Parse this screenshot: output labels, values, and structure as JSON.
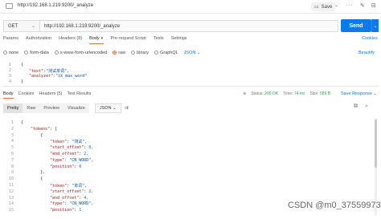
{
  "topbar": {
    "title": "http://192.168.1.219:9200/_analyze",
    "save_label": "Save",
    "save_chevron": "⌄",
    "more": "···",
    "edit_icon": "✎",
    "comment_icon": "⊟"
  },
  "request": {
    "method": "GET",
    "method_caret": "⌄",
    "url": "http://192.168.1.219:9200/_analyze",
    "send_label": "Send",
    "send_dropdown": "⌄"
  },
  "request_tabs": [
    "Params",
    "Authorization",
    "Headers (8)",
    "Body",
    "Pre-request Script",
    "Tests",
    "Settings"
  ],
  "cookies_label": "Cookies",
  "body_types": [
    "none",
    "form-data",
    "x-www-form-urlencoded",
    "raw",
    "binary",
    "GraphQL"
  ],
  "body_format": "JSON",
  "beautify_label": "Beautify",
  "request_body_lines": [
    {
      "n": "1",
      "text": "{"
    },
    {
      "n": "2",
      "key": "\"text\"",
      "sep": ":",
      "val": "\"测试单词\","
    },
    {
      "n": "3",
      "key": "\"analyzer\"",
      "sep": ":",
      "val": "\"ik_max_word\""
    },
    {
      "n": "4",
      "text": "}"
    }
  ],
  "response_tabs": [
    "Body",
    "Cookies",
    "Headers (5)",
    "Test Results"
  ],
  "status": {
    "status_label": "Status:",
    "status_value": "200 OK",
    "time_label": "Time:",
    "time_value": "74 ms",
    "size_label": "Size:",
    "size_value": "589 B"
  },
  "save_response_label": "Save Response",
  "view_buttons": [
    "Pretty",
    "Raw",
    "Preview",
    "Visualize"
  ],
  "response_format": "JSON",
  "response_lines": [
    {
      "n": "1",
      "indent": "",
      "text": "{"
    },
    {
      "n": "2",
      "indent": "    ",
      "key": "\"tokens\"",
      "sep": ": ",
      "val": "["
    },
    {
      "n": "3",
      "indent": "        ",
      "text": "{"
    },
    {
      "n": "4",
      "indent": "            ",
      "key": "\"token\"",
      "sep": ": ",
      "val": "\"测试\","
    },
    {
      "n": "5",
      "indent": "            ",
      "key": "\"start_offset\"",
      "sep": ": ",
      "val": "0,"
    },
    {
      "n": "6",
      "indent": "            ",
      "key": "\"end_offset\"",
      "sep": ": ",
      "val": "2,"
    },
    {
      "n": "7",
      "indent": "            ",
      "key": "\"type\"",
      "sep": ": ",
      "val": "\"CN_WORD\","
    },
    {
      "n": "8",
      "indent": "            ",
      "key": "\"position\"",
      "sep": ": ",
      "val": "0"
    },
    {
      "n": "9",
      "indent": "        ",
      "text": "},"
    },
    {
      "n": "10",
      "indent": "        ",
      "text": "{"
    },
    {
      "n": "11",
      "indent": "            ",
      "key": "\"token\"",
      "sep": ": ",
      "val": "\"单词\","
    },
    {
      "n": "12",
      "indent": "            ",
      "key": "\"start_offset\"",
      "sep": ": ",
      "val": "2,"
    },
    {
      "n": "13",
      "indent": "            ",
      "key": "\"end_offset\"",
      "sep": ": ",
      "val": "4,"
    },
    {
      "n": "14",
      "indent": "            ",
      "key": "\"type\"",
      "sep": ": ",
      "val": "\"CN_WORD\","
    },
    {
      "n": "15",
      "indent": "            ",
      "key": "\"position\"",
      "sep": ": ",
      "val": "1"
    }
  ],
  "watermark": "CSDN @m0_37559973"
}
